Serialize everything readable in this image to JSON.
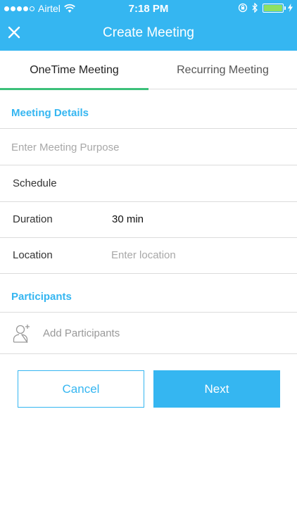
{
  "status_bar": {
    "carrier": "Airtel",
    "time": "7:18 PM",
    "battery_color": "#8ee061"
  },
  "header": {
    "title": "Create Meeting",
    "close_icon": "close-icon",
    "background": "#35b6f1"
  },
  "tabs": [
    {
      "label": "OneTime Meeting",
      "active": true
    },
    {
      "label": "Recurring Meeting",
      "active": false
    }
  ],
  "meeting_details": {
    "section_title": "Meeting Details",
    "purpose_placeholder": "Enter Meeting Purpose",
    "purpose_value": "",
    "schedule_label": "Schedule",
    "duration_label": "Duration",
    "duration_value": "30 min",
    "location_label": "Location",
    "location_placeholder": "Enter location",
    "location_value": ""
  },
  "participants": {
    "section_title": "Participants",
    "add_label": "Add Participants",
    "icon": "add-person-icon"
  },
  "actions": {
    "cancel_label": "Cancel",
    "next_label": "Next"
  },
  "colors": {
    "accent": "#35b6f1",
    "tab_indicator": "#3cc07a"
  }
}
